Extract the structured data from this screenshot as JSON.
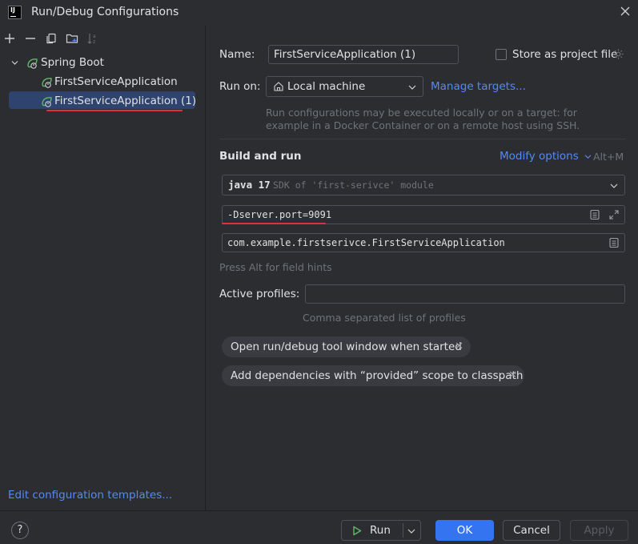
{
  "window": {
    "title": "Run/Debug Configurations",
    "app_icon_text": "IJ"
  },
  "tree": {
    "group": "Spring Boot",
    "items": [
      {
        "label": "FirstServiceApplication"
      },
      {
        "label": "FirstServiceApplication (1)"
      }
    ],
    "edit_templates_link": "Edit configuration templates..."
  },
  "form": {
    "name_label": "Name:",
    "name_value": "FirstServiceApplication (1)",
    "store_label": "Store as project file",
    "store_checked": false,
    "run_on_label": "Run on:",
    "run_on_value": "Local machine",
    "manage_targets": "Manage targets...",
    "run_on_hint_line1": "Run configurations may be executed locally or on a target: for",
    "run_on_hint_line2": "example in a Docker Container or on a remote host using SSH.",
    "section_title": "Build and run",
    "modify_options": "Modify options",
    "modify_shortcut": "Alt+M",
    "jdk_name": "java 17",
    "jdk_desc": "SDK of 'first-serivce' module",
    "vm_options": "-Dserver.port=9091",
    "main_class": "com.example.firstserivce.FirstServiceApplication",
    "field_hint": "Press Alt for field hints",
    "profiles_label": "Active profiles:",
    "profiles_value": "",
    "profiles_hint": "Comma separated list of profiles",
    "tags": [
      {
        "label": "Open run/debug tool window when started"
      },
      {
        "label": "Add dependencies with “provided” scope to classpath"
      }
    ]
  },
  "buttons": {
    "help": "?",
    "run": "Run",
    "ok": "OK",
    "cancel": "Cancel",
    "apply": "Apply"
  },
  "colors": {
    "background": "#2b2d30",
    "selection": "#2e436e",
    "accent": "#3574f0",
    "link": "#548af7",
    "annotation_red": "#e0303a",
    "spring_green": "#5fb865"
  },
  "icons": [
    "add-icon",
    "remove-icon",
    "copy-icon",
    "new-folder-icon",
    "sort-icon",
    "chevron-down-icon",
    "spring-boot-icon",
    "home-icon",
    "gear-icon",
    "expand-icon",
    "document-icon",
    "run-icon",
    "close-icon",
    "help-icon"
  ]
}
